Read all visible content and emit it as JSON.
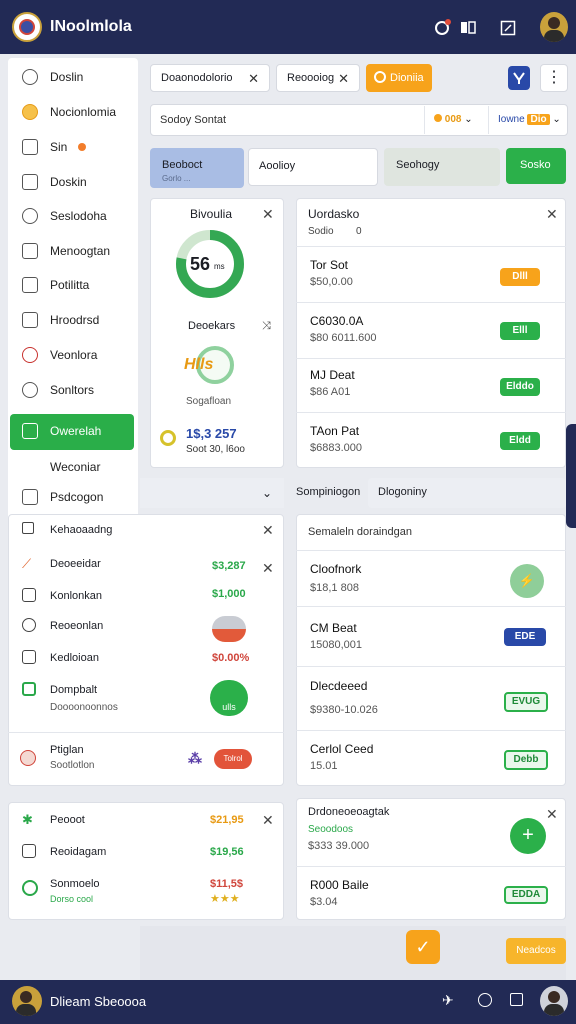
{
  "header": {
    "title": "INoolmlola"
  },
  "sidebar": {
    "items": [
      {
        "label": "Doslin"
      },
      {
        "label": "Nocionlomia"
      },
      {
        "label": "Sin"
      },
      {
        "label": "Doskin"
      },
      {
        "label": "Seslodoha"
      },
      {
        "label": "Menoogtan"
      },
      {
        "label": "Potilitta"
      },
      {
        "label": "Hroodrsd"
      },
      {
        "label": "Veonlora"
      },
      {
        "label": "Sonltors"
      },
      {
        "label": "Owerelah"
      },
      {
        "label": "Weconiar"
      },
      {
        "label": "Psdcogon"
      }
    ]
  },
  "filters": {
    "chip1": "Doaonodolorio",
    "chip2": "Reoooiog",
    "orange_button": "Dioniia",
    "search_placeholder": "Sodoy Sontat",
    "sort_label": "008",
    "view_label": "Iowne",
    "view_badge": "Dio"
  },
  "segments": [
    {
      "label": "Beoboct",
      "sub": "Gorlo ..."
    },
    {
      "label": "Aoolioy"
    },
    {
      "label": "Seohogy"
    },
    {
      "label": "Sosko"
    }
  ],
  "stats_card": {
    "title": "Bivoulia",
    "donut_value": "56",
    "donut_unit": "ms",
    "donut_fraction": 0.78,
    "section2": "Deoekars",
    "badge_text": "Hlls",
    "badge_caption": "Sogafloan",
    "total": "1$,3 257",
    "total_sub": "Soot 30, l6oo"
  },
  "list_card": {
    "title": "Uordasko",
    "subtitle": "Sodio",
    "subtitle_count": "0",
    "rows": [
      {
        "title": "Tor Sot",
        "sub": "$50,0.00",
        "pill": "Dlll",
        "style": "orange"
      },
      {
        "title": "C6030.0A",
        "sub": "$80 6011.600",
        "pill": "Elll",
        "style": "green"
      },
      {
        "title": "MJ Deat",
        "sub": "$86 A01",
        "pill": "Elddo",
        "style": "green"
      },
      {
        "title": "TAon Pat",
        "sub": "$6883.000",
        "pill": "Eldd",
        "style": "green"
      }
    ]
  },
  "middle_bar": {
    "tab1": "Sompiniogon",
    "tab2": "Dlogoniny"
  },
  "finance_card": {
    "header": "Kehaoaadng",
    "rows": [
      {
        "label": "Deoeeidar",
        "value": "$3,287"
      },
      {
        "label": "Konlonkan",
        "value": "$1,000"
      },
      {
        "label": "Reoeonlan",
        "value": ""
      },
      {
        "label": "Kedloioan",
        "value": "$0.00%"
      },
      {
        "label": "Dompbalt",
        "sub": "Doooonoonnos",
        "chip": "ulls"
      }
    ],
    "footer_title": "Ptiglan",
    "footer_sub": "Sootlotlon",
    "footer_badge": "Tolrol"
  },
  "detail_card": {
    "header": "Semaleln doraindgan",
    "rows": [
      {
        "title": "Cloofnork",
        "sub": "$18,1 808"
      },
      {
        "title": "CM Beat",
        "sub": "15080,001",
        "pill": "EDE"
      },
      {
        "title": "Dlecdeeed",
        "sub": "$9380-10.026",
        "pill": "EVUG"
      },
      {
        "title": "Cerlol Ceed",
        "sub": "15.01",
        "pill": "Debb"
      }
    ]
  },
  "small_card": {
    "rows": [
      {
        "label": "Peooot",
        "value": "$21,95"
      },
      {
        "label": "Reoidagam",
        "value": "$19,56"
      },
      {
        "label": "Sonmoelo",
        "sub": "Dorso cool",
        "value": "$11,5$"
      }
    ]
  },
  "bottom_right_card": {
    "title": "Drdoneoeoagtak",
    "sub": "Seoodoos",
    "amount": "$333 39.000",
    "row2_title": "R000 Baile",
    "row2_sub": "$3.04",
    "pill": "EDDA"
  },
  "footer": {
    "title": "Dlieam Sbeoooa",
    "floating_label": "Neadcos"
  }
}
